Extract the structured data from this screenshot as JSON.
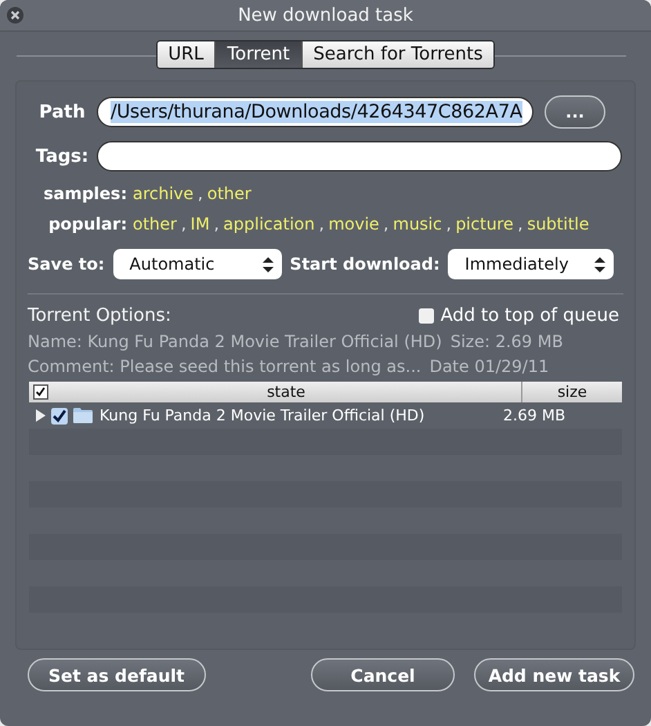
{
  "window": {
    "title": "New download task"
  },
  "tabs": [
    {
      "label": "URL",
      "selected": false
    },
    {
      "label": "Torrent",
      "selected": true
    },
    {
      "label": "Search for Torrents",
      "selected": false
    }
  ],
  "path": {
    "label": "Path",
    "value": "/Users/thurana/Downloads/4264347C862A7A",
    "browse_button": "..."
  },
  "tags": {
    "label": "Tags:",
    "separator": ",",
    "groups": [
      {
        "label": "samples:",
        "items": [
          "archive",
          "other"
        ]
      },
      {
        "label": "popular:",
        "items": [
          "other",
          "IM",
          "application",
          "movie",
          "music",
          "picture",
          "subtitle"
        ]
      }
    ]
  },
  "save_to": {
    "label": "Save to:",
    "value": "Automatic"
  },
  "start_download": {
    "label": "Start download:",
    "value": "Immediately"
  },
  "torrent_options": {
    "title": "Torrent Options:",
    "add_to_top": {
      "label": "Add to top of queue",
      "checked": false
    },
    "name": "Name: Kung Fu Panda 2 Movie Trailer Official (HD)",
    "size": "Size: 2.69 MB",
    "comment": "Comment: Please seed this torrent as long as...",
    "date": "Date 01/29/11"
  },
  "table": {
    "select_all": true,
    "columns": [
      "state",
      "size"
    ],
    "rows": [
      {
        "name": "Kung Fu Panda 2 Movie Trailer Official (HD)",
        "size": "2.69 MB",
        "checked": true,
        "expanded": false
      }
    ]
  },
  "buttons": {
    "left": [
      "Set as default"
    ],
    "right": [
      "Cancel",
      "Add new task"
    ]
  }
}
